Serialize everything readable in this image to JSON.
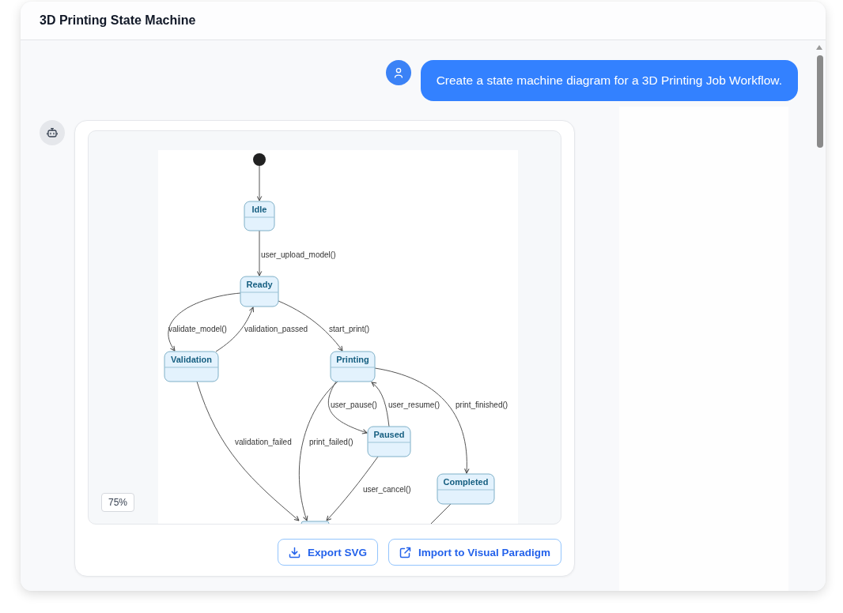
{
  "window": {
    "title": "3D Printing State Machine"
  },
  "messages": [
    {
      "kind": "user",
      "text": "Create a state machine diagram for a 3D Printing Job Workflow."
    },
    {
      "kind": "assistant",
      "diagram": {
        "states": [
          {
            "kind": "initial"
          },
          {
            "kind": "state",
            "name": "Idle"
          },
          {
            "kind": "state",
            "name": "Ready"
          },
          {
            "kind": "state",
            "name": "Validation"
          },
          {
            "kind": "state",
            "name": "Printing"
          },
          {
            "kind": "state",
            "name": "Paused"
          },
          {
            "kind": "state",
            "name": "Completed"
          },
          {
            "kind": "clipped_state"
          }
        ],
        "transitions": [
          {
            "kind": "plain"
          },
          {
            "kind": "labeled",
            "label": "user_upload_model()"
          },
          {
            "kind": "labeled",
            "label": "validate_model()"
          },
          {
            "kind": "labeled",
            "label": "validation_passed"
          },
          {
            "kind": "labeled",
            "label": "start_print()"
          },
          {
            "kind": "labeled",
            "label": "user_pause()"
          },
          {
            "kind": "labeled",
            "label": "user_resume()"
          },
          {
            "kind": "labeled",
            "label": "print_finished()"
          },
          {
            "kind": "labeled",
            "label": "validation_failed"
          },
          {
            "kind": "labeled",
            "label": "print_failed()"
          },
          {
            "kind": "labeled",
            "label": "user_cancel()"
          },
          {
            "kind": "plain"
          }
        ]
      },
      "zoom": "75%",
      "actions": [
        {
          "kind": "download",
          "label": "Export SVG"
        },
        {
          "kind": "external",
          "label": "Import to Visual Paradigm"
        }
      ]
    }
  ]
}
